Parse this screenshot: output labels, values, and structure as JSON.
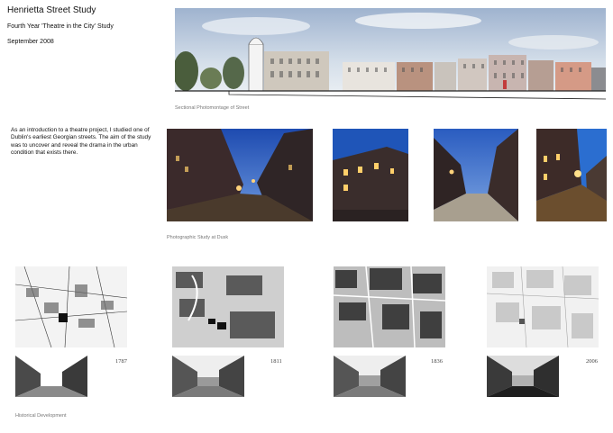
{
  "header": {
    "title": "Henrietta Street Study",
    "subtitle": "Fourth Year 'Theatre in the City' Study",
    "date": "September 2008"
  },
  "street_section": {
    "caption": "Sectional Photomontage of Street"
  },
  "intro": {
    "text": "As an introduction to a theatre project, I studied one of Dublin's earliest Georgian streets. The aim of the study was to uncover and reveal the drama in the urban condition that exists there."
  },
  "dusk_study": {
    "caption": "Photographic Study at Dusk"
  },
  "historical": {
    "caption": "Historical Development",
    "years": [
      "1787",
      "1811",
      "1836",
      "2006"
    ]
  }
}
